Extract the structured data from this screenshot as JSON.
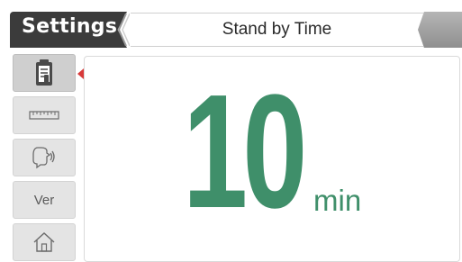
{
  "header": {
    "settings_label": "Settings",
    "title": "Stand by Time"
  },
  "sidebar": {
    "items": [
      {
        "name": "clipboard-icon",
        "active": true
      },
      {
        "name": "ruler-icon",
        "active": false
      },
      {
        "name": "voice-icon",
        "active": false
      },
      {
        "name": "version",
        "label": "Ver",
        "active": false
      },
      {
        "name": "home-icon",
        "active": false
      }
    ]
  },
  "main": {
    "value": "10",
    "unit": "min"
  },
  "colors": {
    "accent": "#3f8f6a",
    "header_dark": "#3b3b3b",
    "marker": "#d83a3a"
  }
}
